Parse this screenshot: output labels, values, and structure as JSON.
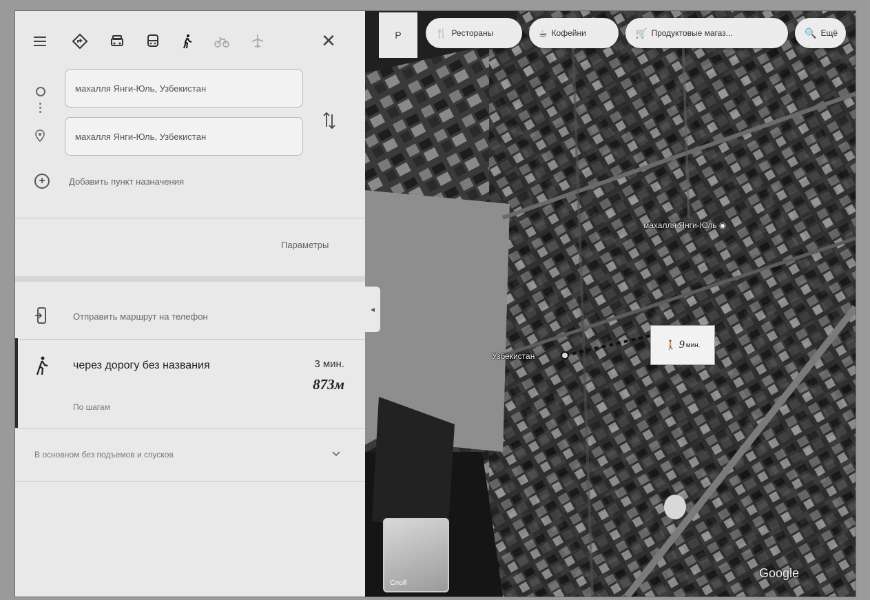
{
  "modes": {
    "menu_icon": "hamburger-icon",
    "items": [
      "directions-icon",
      "car-icon",
      "transit-icon",
      "walk-icon",
      "bicycle-icon",
      "flight-icon"
    ],
    "active": "walk-icon"
  },
  "route": {
    "origin_value": "махалля Янги-Юль, Узбекистан",
    "destination_value": "махалля Янги-Юль, Узбекистан",
    "add_destination": "Добавить пункт назначения"
  },
  "options": {
    "params_label": "Параметры",
    "send_to_phone": "Отправить маршрут на телефон"
  },
  "result": {
    "via": "через дорогу без названия",
    "time": "3 мин.",
    "distance": "873м",
    "steps_link": "По шагам",
    "flat_note": "В основном без подъемов и спусков"
  },
  "map": {
    "layer_chip": "Р",
    "chips": [
      {
        "label": "Рестораны",
        "icon": "fork-knife-icon"
      },
      {
        "label": "Кофейни",
        "icon": "coffee-icon"
      },
      {
        "label": "Продуктовые магаз...",
        "icon": "cart-icon"
      },
      {
        "label": "Ещё",
        "icon": "search-icon"
      }
    ],
    "place_label": "махалля Янги-Юль",
    "place_label_2": "Узбекистан",
    "walk_badge_time": "9",
    "walk_badge_unit": "мин.",
    "thumbnail_label": "Слой",
    "brand": "Google"
  }
}
